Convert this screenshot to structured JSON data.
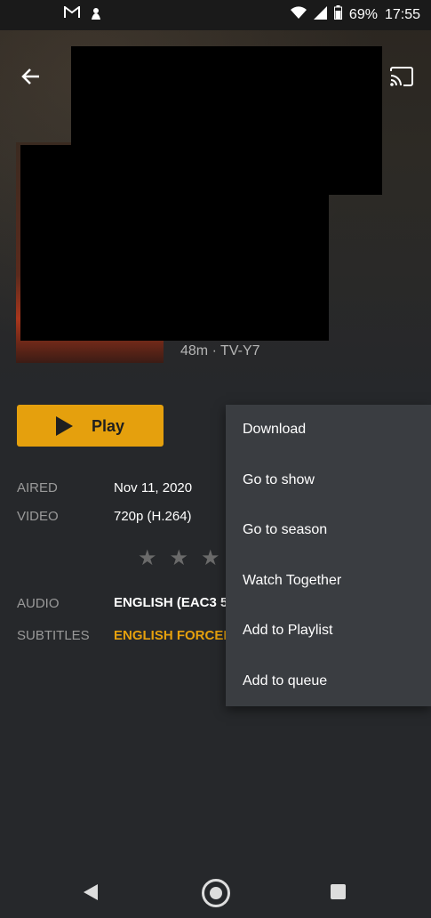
{
  "status_bar": {
    "left_icons": [
      "gmail-icon",
      "notification-icon"
    ],
    "battery_percent": "69%",
    "time": "17:55"
  },
  "header": {
    "back_icon": "arrow-left-icon",
    "cast_icon": "cast-icon"
  },
  "episode": {
    "meta": "48m · TV-Y7"
  },
  "play_button": {
    "label": "Play"
  },
  "info": {
    "aired_label": "AIRED",
    "aired_value": "Nov 11, 2020",
    "video_label": "VIDEO",
    "video_value": "720p (H.264)",
    "audio_label": "AUDIO",
    "audio_value": "ENGLISH (EAC3 5",
    "subtitles_label": "SUBTITLES",
    "subtitles_value": "ENGLISH FORCED"
  },
  "rating": {
    "stars_filled": 0,
    "stars_total": 5
  },
  "context_menu": {
    "items": [
      "Download",
      "Go to show",
      "Go to season",
      "Watch Together",
      "Add to Playlist",
      "Add to queue"
    ]
  },
  "colors": {
    "accent": "#e5a00d",
    "background": "#26282b",
    "menu_background": "#3a3d41",
    "subtitle_accent": "#e5a00d"
  }
}
